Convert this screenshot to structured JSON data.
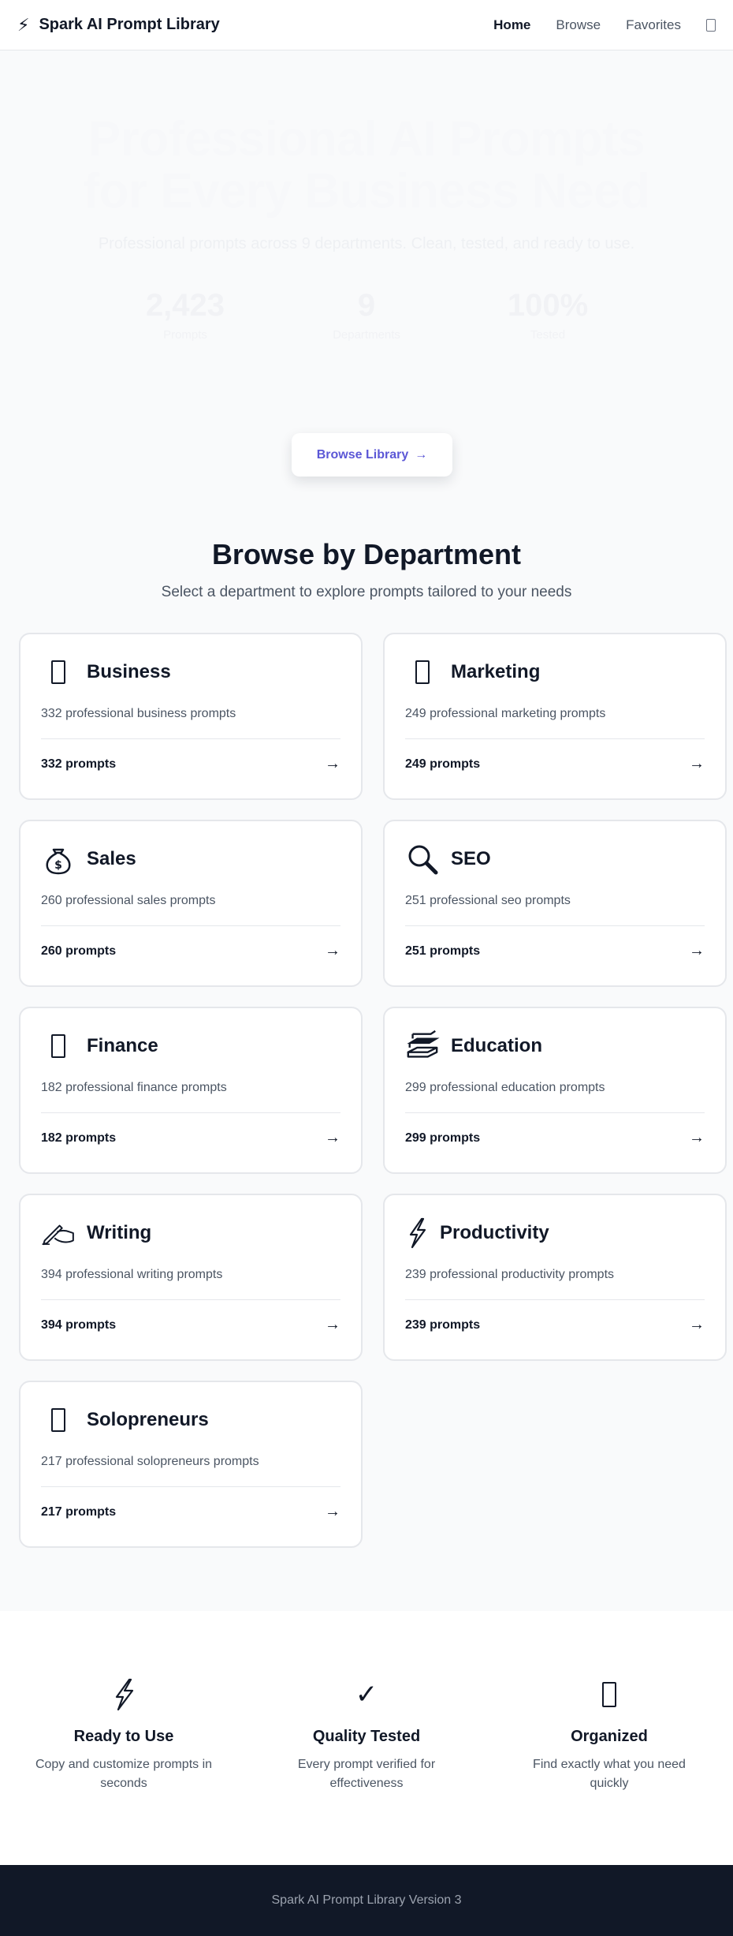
{
  "header": {
    "brand_icon": "⚡",
    "brand_name": "Spark AI Prompt Library",
    "nav": [
      {
        "label": "Home",
        "active": true
      },
      {
        "label": "Browse",
        "active": false
      },
      {
        "label": "Favorites",
        "active": false
      }
    ],
    "theme_toggle_icon": "moon-icon"
  },
  "hero": {
    "title_line1": "Professional AI Prompts",
    "title_line2": "for Every Business Need",
    "subtitle": "Professional prompts across 9 departments. Clean, tested, and ready to use.",
    "stats": [
      {
        "value": "2,423",
        "label": "Prompts"
      },
      {
        "value": "9",
        "label": "Departments"
      },
      {
        "value": "100%",
        "label": "Tested"
      }
    ],
    "cta_label": "Browse Library",
    "cta_arrow": "→"
  },
  "departments": {
    "title": "Browse by Department",
    "description": "Select a department to explore prompts tailored to your needs",
    "items": [
      {
        "icon": "briefcase-icon",
        "glyph": "",
        "name": "Business",
        "desc": "332 professional business prompts",
        "count": "332 prompts"
      },
      {
        "icon": "megaphone-icon",
        "glyph": "",
        "name": "Marketing",
        "desc": "249 professional marketing prompts",
        "count": "249 prompts"
      },
      {
        "icon": "money-bag-icon",
        "glyph": "💰",
        "name": "Sales",
        "desc": "260 professional sales prompts",
        "count": "260 prompts"
      },
      {
        "icon": "magnifier-icon",
        "glyph": "🔍",
        "name": "SEO",
        "desc": "251 professional seo prompts",
        "count": "251 prompts"
      },
      {
        "icon": "chart-icon",
        "glyph": "",
        "name": "Finance",
        "desc": "182 professional finance prompts",
        "count": "182 prompts"
      },
      {
        "icon": "books-icon",
        "glyph": "📚",
        "name": "Education",
        "desc": "299 professional education prompts",
        "count": "299 prompts"
      },
      {
        "icon": "writing-hand-icon",
        "glyph": "✍",
        "name": "Writing",
        "desc": "394 professional writing prompts",
        "count": "394 prompts"
      },
      {
        "icon": "bolt-icon",
        "glyph": "⚡",
        "name": "Productivity",
        "desc": "239 professional productivity prompts",
        "count": "239 prompts"
      },
      {
        "icon": "rocket-icon",
        "glyph": "",
        "name": "Solopreneurs",
        "desc": "217 professional solopreneurs prompts",
        "count": "217 prompts"
      }
    ],
    "arrow": "→"
  },
  "features": [
    {
      "icon": "bolt-icon",
      "glyph": "⚡",
      "title": "Ready to Use",
      "text": "Copy and customize prompts in seconds"
    },
    {
      "icon": "check-icon",
      "glyph": "✓",
      "title": "Quality Tested",
      "text": "Every prompt verified for effectiveness"
    },
    {
      "icon": "folder-icon",
      "glyph": "",
      "title": "Organized",
      "text": "Find exactly what you need quickly"
    }
  ],
  "footer": {
    "text": "Spark AI Prompt Library Version 3"
  }
}
